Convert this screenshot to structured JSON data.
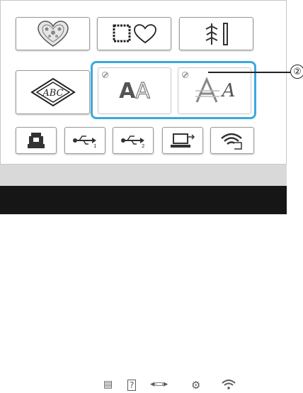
{
  "callout": {
    "number": "②"
  },
  "categories": [
    {
      "name": "decorative-patterns",
      "icon": "lace-heart-icon"
    },
    {
      "name": "frame-patterns",
      "icon": "frame-heart-icon"
    },
    {
      "name": "utility-stitches",
      "icon": "stitch-lines-icon"
    },
    {
      "name": "monogram",
      "icon": "monogram-diamond-icon"
    },
    {
      "name": "alphabet-fonts",
      "icon": "alphabet-icon",
      "text_a1": "A",
      "text_a2": "A",
      "disabled": true
    },
    {
      "name": "script-fonts",
      "icon": "script-font-icon",
      "text_script": "A",
      "disabled": true
    }
  ],
  "bottom_buttons": [
    {
      "name": "machine-memory",
      "icon": "machine-icon"
    },
    {
      "name": "usb-1",
      "icon": "usb-icon",
      "sub": "1"
    },
    {
      "name": "usb-2",
      "icon": "usb-icon",
      "sub": "2"
    },
    {
      "name": "computer",
      "icon": "computer-icon"
    },
    {
      "name": "wireless",
      "icon": "wifi-icon"
    }
  ],
  "status_icons": [
    "page-icon",
    "help-icon",
    "connection-icon",
    "settings-icon",
    "wifi-status-icon"
  ],
  "colors": {
    "selection": "#3aa8e0",
    "statusbar": "#161616"
  }
}
